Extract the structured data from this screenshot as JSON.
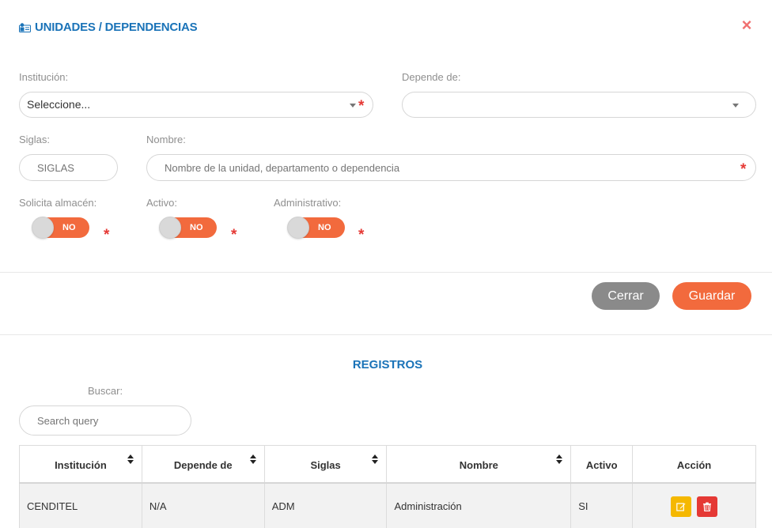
{
  "modal": {
    "title": "UNIDADES / DEPENDENCIAS",
    "close_symbol": "×"
  },
  "form": {
    "institucion": {
      "label": "Institución:",
      "value": "Seleccione...",
      "required_mark": "*"
    },
    "depende_de": {
      "label": "Depende de:",
      "value": ""
    },
    "siglas": {
      "label": "Siglas:",
      "placeholder": "SIGLAS"
    },
    "nombre": {
      "label": "Nombre:",
      "placeholder": "Nombre de la unidad, departamento o dependencia",
      "required_mark": "*"
    },
    "solicita_almacen": {
      "label": "Solicita almacén:",
      "state": "NO",
      "required_mark": "*"
    },
    "activo": {
      "label": "Activo:",
      "state": "NO",
      "required_mark": "*"
    },
    "administrativo": {
      "label": "Administrativo:",
      "state": "NO",
      "required_mark": "*"
    }
  },
  "buttons": {
    "cerrar": "Cerrar",
    "guardar": "Guardar"
  },
  "registros": {
    "title": "REGISTROS",
    "search_label": "Buscar:",
    "search_placeholder": "Search query",
    "columns": [
      "Institución",
      "Depende de",
      "Siglas",
      "Nombre",
      "Activo",
      "Acción"
    ],
    "rows": [
      {
        "institucion": "CENDITEL",
        "depende_de": "N/A",
        "siglas": "ADM",
        "nombre": "Administración",
        "activo": "SI"
      }
    ]
  },
  "colors": {
    "accent_blue": "#1a73b8",
    "accent_orange": "#f26a3d",
    "required_red": "#e53935",
    "edit_yellow": "#f5b800",
    "delete_red": "#e53935"
  },
  "icons": [
    "address-card-icon",
    "close-icon",
    "caret-down-icon",
    "sort-icon",
    "edit-icon",
    "trash-icon"
  ]
}
